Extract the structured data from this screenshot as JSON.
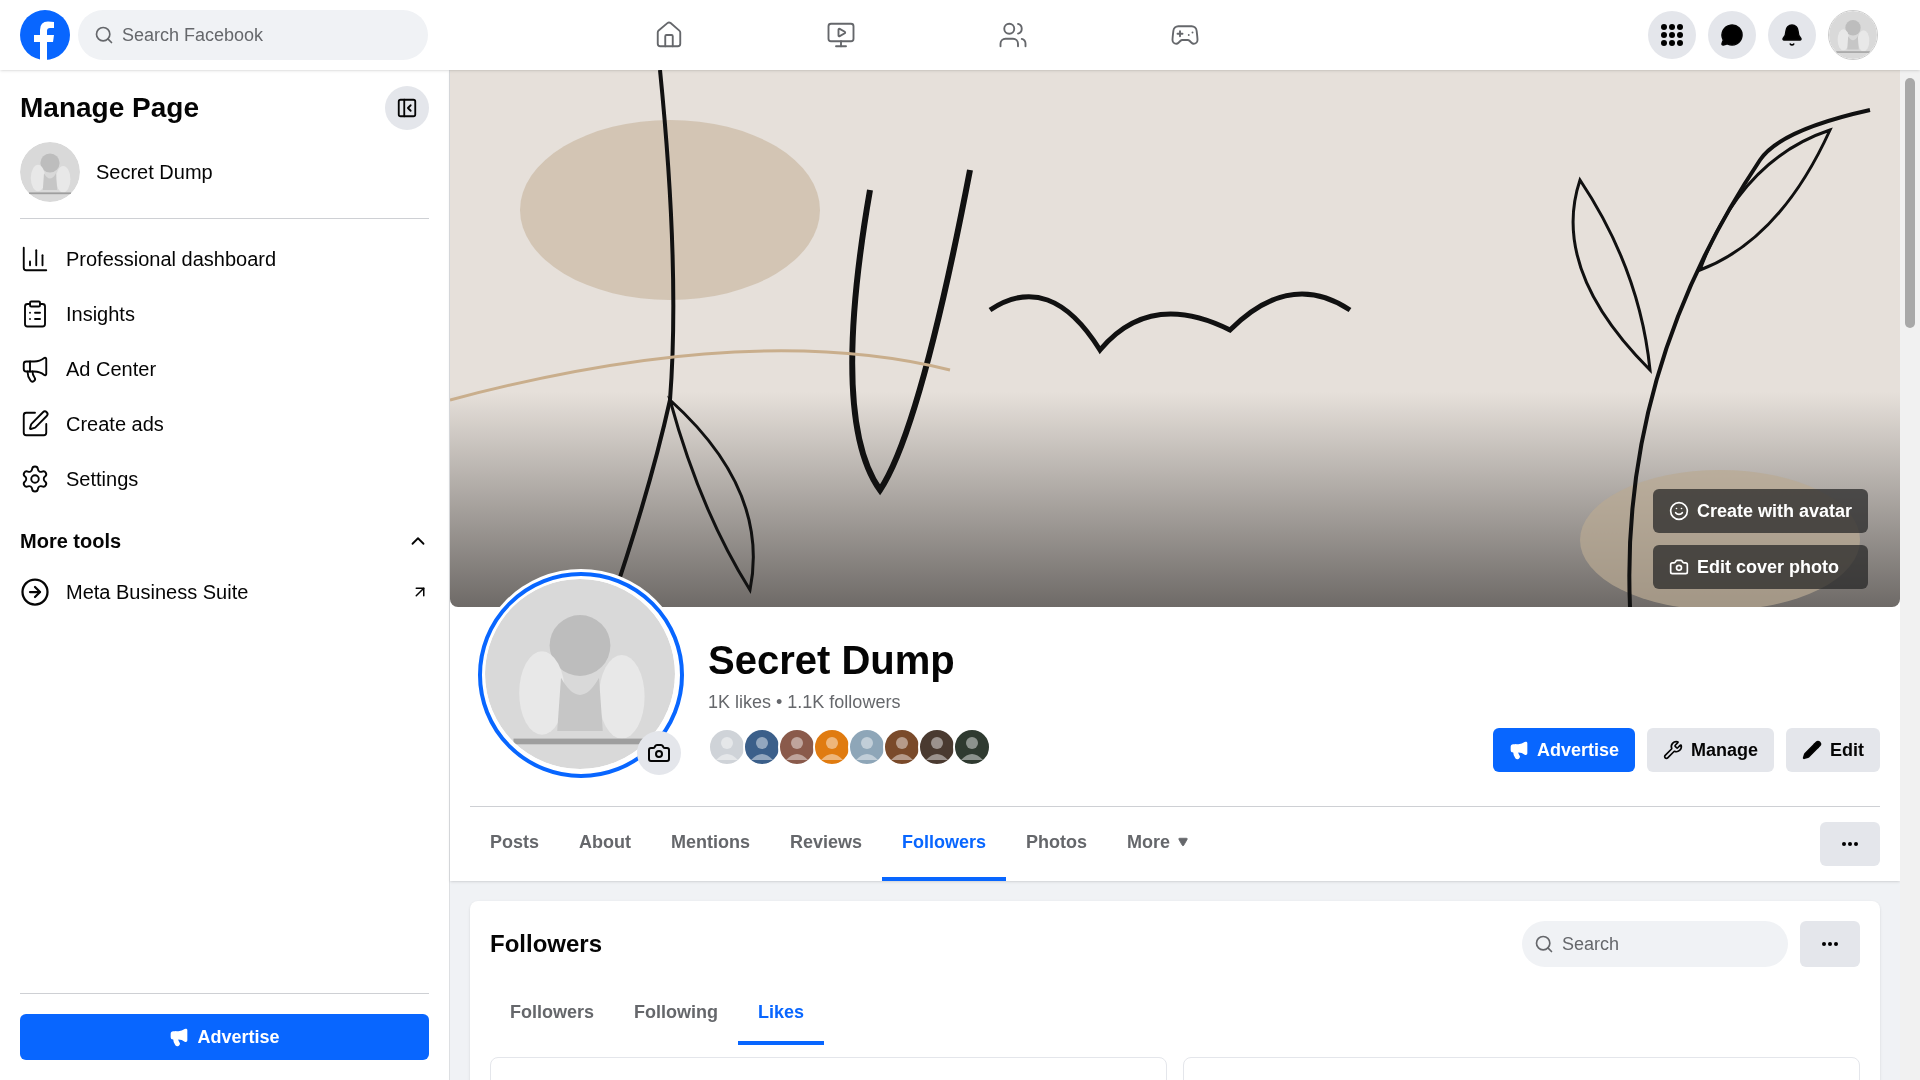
{
  "top_bar": {
    "search": {
      "placeholder": "Search Facebook"
    }
  },
  "sidebar": {
    "title": "Manage Page",
    "page_name": "Secret Dump",
    "items": [
      {
        "label": "Professional dashboard"
      },
      {
        "label": "Insights"
      },
      {
        "label": "Ad Center"
      },
      {
        "label": "Create ads"
      },
      {
        "label": "Settings"
      }
    ],
    "more_tools": {
      "label": "More tools",
      "expanded": true,
      "items": [
        {
          "label": "Meta Business Suite"
        }
      ]
    },
    "advertise_button": "Advertise"
  },
  "cover": {
    "buttons": [
      "Create with avatar",
      "Edit cover photo"
    ]
  },
  "profile": {
    "name": "Secret Dump",
    "stats": "1K likes • 1.1K followers",
    "actions": [
      "Advertise",
      "Manage",
      "Edit"
    ]
  },
  "tabs": [
    {
      "label": "Posts",
      "selected": false
    },
    {
      "label": "About",
      "selected": false
    },
    {
      "label": "Mentions",
      "selected": false
    },
    {
      "label": "Reviews",
      "selected": false
    },
    {
      "label": "Followers",
      "selected": true
    },
    {
      "label": "Photos",
      "selected": false
    },
    {
      "label": "More",
      "selected": false
    }
  ],
  "followers_card": {
    "title": "Followers",
    "search": {
      "placeholder": "Search"
    },
    "tabs": [
      {
        "label": "Followers",
        "selected": false
      },
      {
        "label": "Following",
        "selected": false
      },
      {
        "label": "Likes",
        "selected": true
      }
    ]
  }
}
